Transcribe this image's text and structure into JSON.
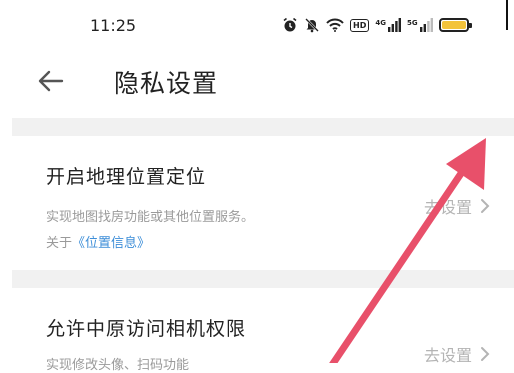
{
  "status_bar": {
    "time": "11:25",
    "hd_label": "HD",
    "signal1_label": "4G",
    "signal2_label": "5G",
    "battery_color": "#f3c33b"
  },
  "header": {
    "title": "隐私设置"
  },
  "settings": [
    {
      "title": "开启地理位置定位",
      "description": "实现地图找房功能或其他位置服务。",
      "about_prefix": "关于",
      "about_link": "《位置信息》",
      "action": "去设置"
    },
    {
      "title": "允许中原访问相机权限",
      "description": "实现修改头像、扫码功能",
      "action": "去设置"
    }
  ],
  "colors": {
    "link": "#3d8ed8",
    "annotation_arrow": "#e8506a",
    "separator": "#f1f1f1"
  }
}
